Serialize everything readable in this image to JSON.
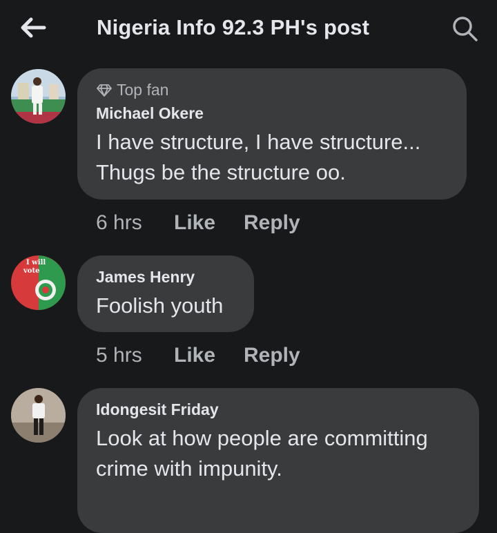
{
  "header": {
    "title": "Nigeria Info 92.3 PH's post",
    "back_icon": "arrow-left-icon",
    "search_icon": "search-icon"
  },
  "comments": [
    {
      "badge": "Top fan",
      "author": "Michael Okere",
      "text_lines": [
        "I have structure, I have structure...",
        "Thugs be the structure oo."
      ],
      "time": "6 hrs",
      "like": "Like",
      "reply": "Reply"
    },
    {
      "author": "James Henry",
      "avatar_text_line1": "I will",
      "avatar_text_line2": "vote",
      "text_lines": [
        "Foolish youth"
      ],
      "time": "5 hrs",
      "like": "Like",
      "reply": "Reply"
    },
    {
      "author": "Idongesit Friday",
      "text_lines": [
        "Look at how people are committing",
        "crime with impunity."
      ]
    }
  ],
  "colors": {
    "background": "#18191a",
    "bubble": "#3a3b3c",
    "primary_text": "#e4e6eb",
    "secondary_text": "#b0b3b8"
  }
}
